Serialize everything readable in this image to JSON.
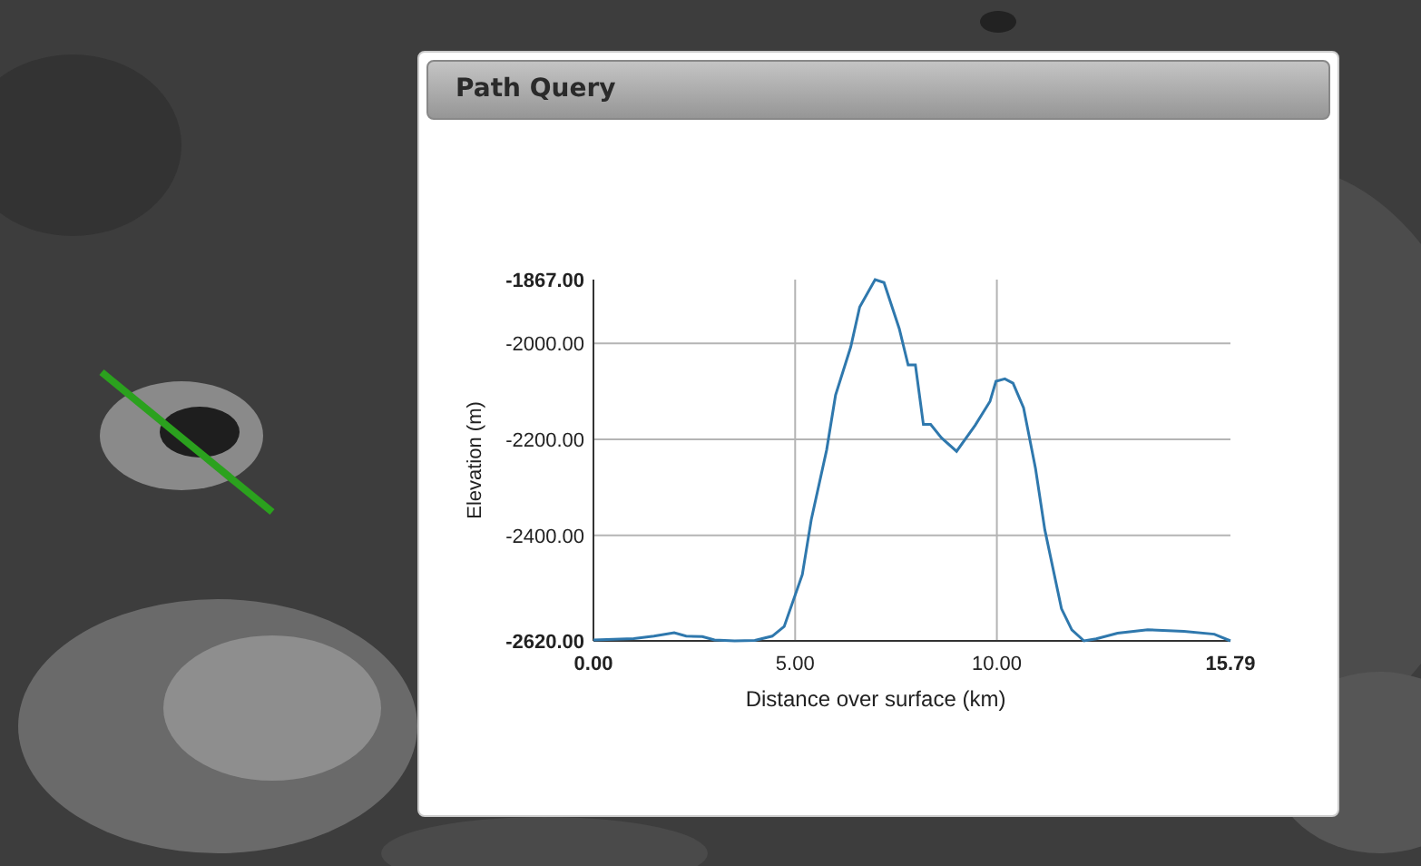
{
  "panel": {
    "title": "Path Query",
    "chart_data": {
      "type": "line",
      "xlabel": "Distance over surface (km)",
      "ylabel": "Elevation (m)",
      "x": [
        0,
        1,
        1.5,
        2,
        2.3,
        2.7,
        3,
        3.5,
        4,
        4.43,
        4.73,
        5.18,
        5.4,
        5.78,
        6,
        6.38,
        6.6,
        6.98,
        7.2,
        7.58,
        7.8,
        7.98,
        8.18,
        8.36,
        8.63,
        9,
        9.46,
        9.83,
        9.98,
        10.2,
        10.4,
        10.66,
        10.96,
        11.19,
        11.6,
        11.86,
        12.16,
        12.46,
        12.99,
        13.74,
        14.64,
        15.39,
        15.79
      ],
      "grid": true,
      "series": [
        {
          "color": "#2f78ad",
          "values": [
            -2618,
            -2615,
            -2610,
            -2603,
            -2610,
            -2611,
            -2618,
            -2620,
            -2619,
            -2610,
            -2590,
            -2482,
            -2368,
            -2222,
            -2108,
            -2007,
            -1924,
            -1867,
            -1873,
            -1969,
            -2045,
            -2045,
            -2169,
            -2169,
            -2197,
            -2225,
            -2171,
            -2121,
            -2079,
            -2074,
            -2083,
            -2134,
            -2261,
            -2388,
            -2553,
            -2597,
            -2620,
            -2616,
            -2604,
            -2597,
            -2600,
            -2606,
            -2620
          ]
        }
      ],
      "xlim": [
        0,
        15.79
      ],
      "ylim": [
        -2620,
        -1867
      ],
      "xticks": [
        {
          "value": 0,
          "label": "0.00"
        },
        {
          "value": 5,
          "label": "5.00"
        },
        {
          "value": 10,
          "label": "10.00"
        },
        {
          "value": 15.79,
          "label": "15.79"
        }
      ],
      "yticks": [
        {
          "value": -2620,
          "label": "-2620.00"
        },
        {
          "value": -2400,
          "label": "-2400.00"
        },
        {
          "value": -2200,
          "label": "-2200.00"
        },
        {
          "value": -2000,
          "label": "-2000.00"
        },
        {
          "value": -1867,
          "label": "-1867.00"
        }
      ]
    }
  }
}
